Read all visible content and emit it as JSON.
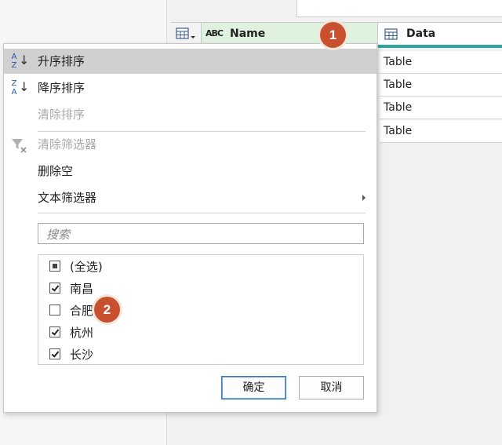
{
  "grid": {
    "columns": [
      {
        "type_icon": "abc-text-type-icon",
        "label": "Name"
      },
      {
        "type_icon": "table-type-icon",
        "label": "Data"
      }
    ],
    "type_icon_glyph": "ABC",
    "data_cells": [
      "Table",
      "Table",
      "Table",
      "Table"
    ]
  },
  "menu": {
    "sort_asc": "升序排序",
    "sort_desc": "降序排序",
    "clear_sort": "清除排序",
    "clear_filter": "清除筛选器",
    "remove_empty": "删除空",
    "text_filters": "文本筛选器",
    "search_placeholder": "搜索",
    "items": [
      {
        "label": "(全选)",
        "state": "partial"
      },
      {
        "label": "南昌",
        "state": "checked"
      },
      {
        "label": "合肥",
        "state": "unchecked"
      },
      {
        "label": "杭州",
        "state": "checked"
      },
      {
        "label": "长沙",
        "state": "checked"
      }
    ],
    "ok": "确定",
    "cancel": "取消"
  },
  "annotations": {
    "badge1": "1",
    "badge2": "2"
  },
  "colors": {
    "accent_teal": "#2fa3a0",
    "badge": "#c9502e",
    "name_header_bg": "#dff2df",
    "selected_row": "#d0d0d0"
  }
}
